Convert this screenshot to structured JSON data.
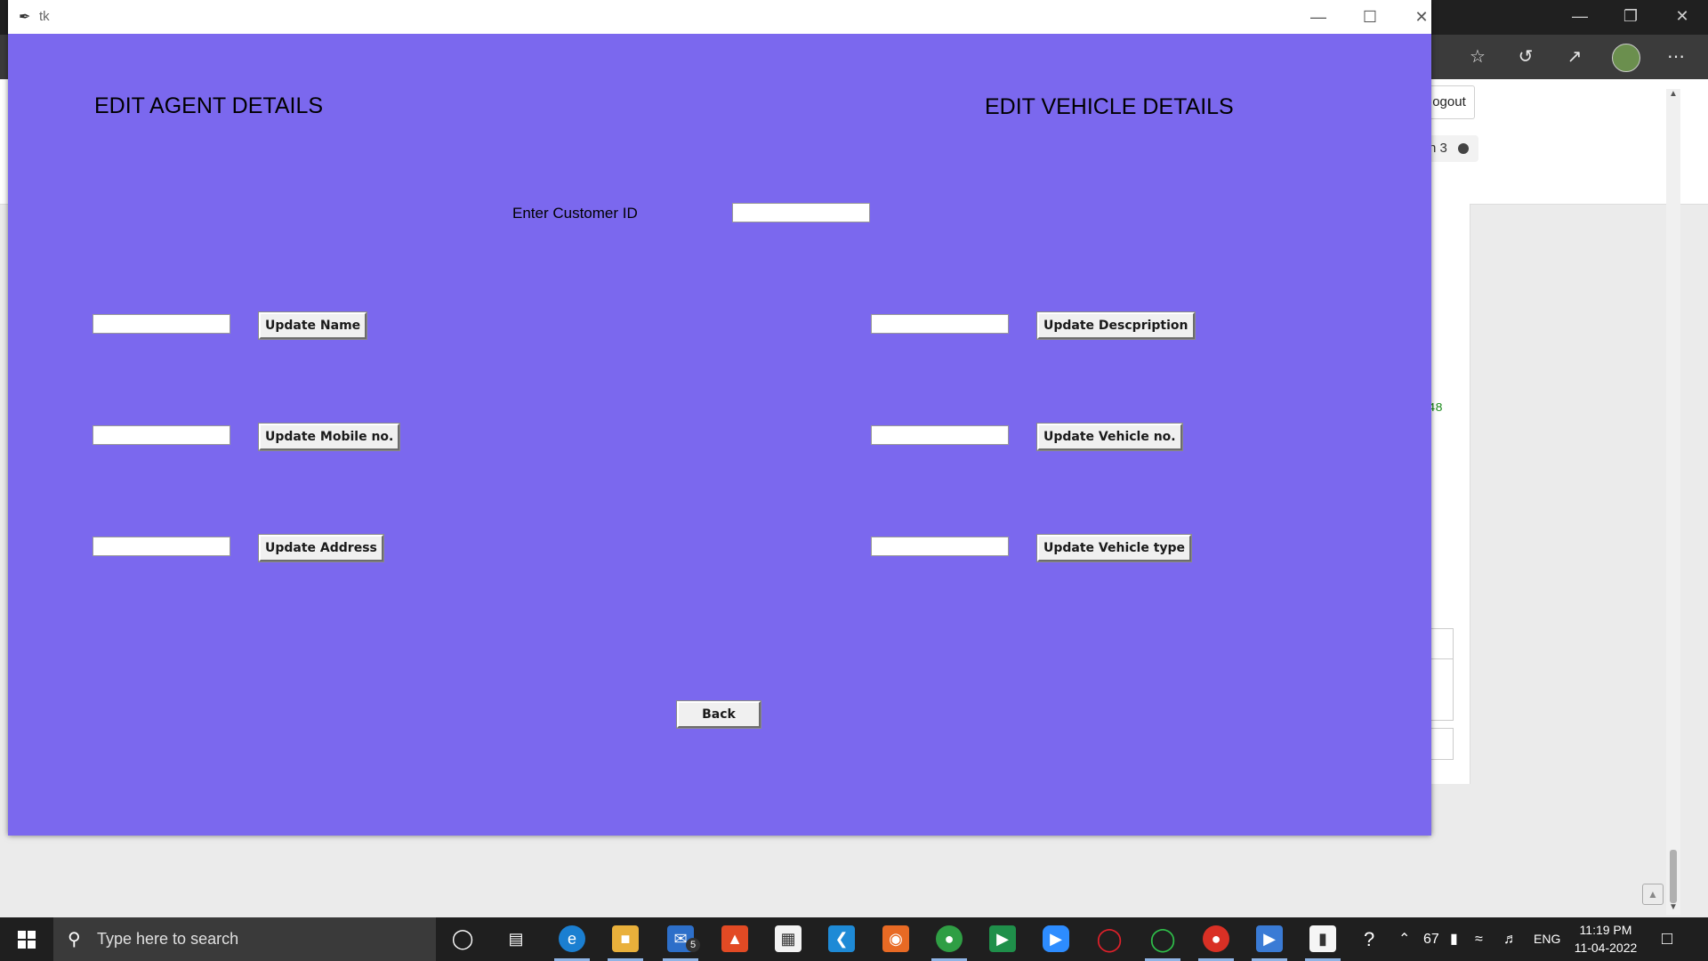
{
  "background": {
    "logout_label": "ogout",
    "pill_label": "n 3",
    "green_text": "48"
  },
  "window": {
    "title": "tk",
    "accent_color": "#7B68EE"
  },
  "agent": {
    "heading": "EDIT AGENT DETAILS",
    "update_name": "Update Name",
    "update_mobile": "Update Mobile no.",
    "update_address": "Update Address",
    "name_value": "",
    "mobile_value": "",
    "address_value": ""
  },
  "vehicle": {
    "heading": "EDIT VEHICLE DETAILS",
    "update_description": "Update Descpription",
    "update_vehicle_no": "Update Vehicle no.",
    "update_vehicle_type": "Update Vehicle type",
    "description_value": "",
    "vehicle_no_value": "",
    "vehicle_type_value": ""
  },
  "customer": {
    "label": "Enter Customer ID",
    "value": ""
  },
  "back_label": "Back",
  "taskbar": {
    "search_placeholder": "Type here to search",
    "mail_badge": "5",
    "battery": "67",
    "language": "ENG",
    "time": "11:19 PM",
    "date": "11-04-2022"
  }
}
